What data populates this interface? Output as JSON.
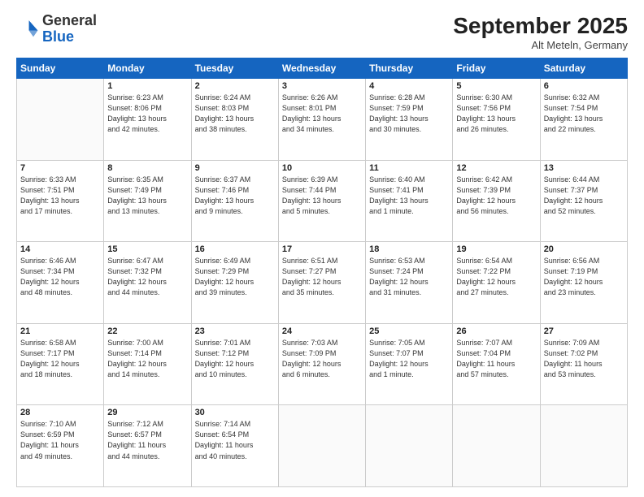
{
  "header": {
    "logo_general": "General",
    "logo_blue": "Blue",
    "month_title": "September 2025",
    "location": "Alt Meteln, Germany"
  },
  "days_of_week": [
    "Sunday",
    "Monday",
    "Tuesday",
    "Wednesday",
    "Thursday",
    "Friday",
    "Saturday"
  ],
  "weeks": [
    [
      {
        "day": "",
        "info": ""
      },
      {
        "day": "1",
        "info": "Sunrise: 6:23 AM\nSunset: 8:06 PM\nDaylight: 13 hours\nand 42 minutes."
      },
      {
        "day": "2",
        "info": "Sunrise: 6:24 AM\nSunset: 8:03 PM\nDaylight: 13 hours\nand 38 minutes."
      },
      {
        "day": "3",
        "info": "Sunrise: 6:26 AM\nSunset: 8:01 PM\nDaylight: 13 hours\nand 34 minutes."
      },
      {
        "day": "4",
        "info": "Sunrise: 6:28 AM\nSunset: 7:59 PM\nDaylight: 13 hours\nand 30 minutes."
      },
      {
        "day": "5",
        "info": "Sunrise: 6:30 AM\nSunset: 7:56 PM\nDaylight: 13 hours\nand 26 minutes."
      },
      {
        "day": "6",
        "info": "Sunrise: 6:32 AM\nSunset: 7:54 PM\nDaylight: 13 hours\nand 22 minutes."
      }
    ],
    [
      {
        "day": "7",
        "info": "Sunrise: 6:33 AM\nSunset: 7:51 PM\nDaylight: 13 hours\nand 17 minutes."
      },
      {
        "day": "8",
        "info": "Sunrise: 6:35 AM\nSunset: 7:49 PM\nDaylight: 13 hours\nand 13 minutes."
      },
      {
        "day": "9",
        "info": "Sunrise: 6:37 AM\nSunset: 7:46 PM\nDaylight: 13 hours\nand 9 minutes."
      },
      {
        "day": "10",
        "info": "Sunrise: 6:39 AM\nSunset: 7:44 PM\nDaylight: 13 hours\nand 5 minutes."
      },
      {
        "day": "11",
        "info": "Sunrise: 6:40 AM\nSunset: 7:41 PM\nDaylight: 13 hours\nand 1 minute."
      },
      {
        "day": "12",
        "info": "Sunrise: 6:42 AM\nSunset: 7:39 PM\nDaylight: 12 hours\nand 56 minutes."
      },
      {
        "day": "13",
        "info": "Sunrise: 6:44 AM\nSunset: 7:37 PM\nDaylight: 12 hours\nand 52 minutes."
      }
    ],
    [
      {
        "day": "14",
        "info": "Sunrise: 6:46 AM\nSunset: 7:34 PM\nDaylight: 12 hours\nand 48 minutes."
      },
      {
        "day": "15",
        "info": "Sunrise: 6:47 AM\nSunset: 7:32 PM\nDaylight: 12 hours\nand 44 minutes."
      },
      {
        "day": "16",
        "info": "Sunrise: 6:49 AM\nSunset: 7:29 PM\nDaylight: 12 hours\nand 39 minutes."
      },
      {
        "day": "17",
        "info": "Sunrise: 6:51 AM\nSunset: 7:27 PM\nDaylight: 12 hours\nand 35 minutes."
      },
      {
        "day": "18",
        "info": "Sunrise: 6:53 AM\nSunset: 7:24 PM\nDaylight: 12 hours\nand 31 minutes."
      },
      {
        "day": "19",
        "info": "Sunrise: 6:54 AM\nSunset: 7:22 PM\nDaylight: 12 hours\nand 27 minutes."
      },
      {
        "day": "20",
        "info": "Sunrise: 6:56 AM\nSunset: 7:19 PM\nDaylight: 12 hours\nand 23 minutes."
      }
    ],
    [
      {
        "day": "21",
        "info": "Sunrise: 6:58 AM\nSunset: 7:17 PM\nDaylight: 12 hours\nand 18 minutes."
      },
      {
        "day": "22",
        "info": "Sunrise: 7:00 AM\nSunset: 7:14 PM\nDaylight: 12 hours\nand 14 minutes."
      },
      {
        "day": "23",
        "info": "Sunrise: 7:01 AM\nSunset: 7:12 PM\nDaylight: 12 hours\nand 10 minutes."
      },
      {
        "day": "24",
        "info": "Sunrise: 7:03 AM\nSunset: 7:09 PM\nDaylight: 12 hours\nand 6 minutes."
      },
      {
        "day": "25",
        "info": "Sunrise: 7:05 AM\nSunset: 7:07 PM\nDaylight: 12 hours\nand 1 minute."
      },
      {
        "day": "26",
        "info": "Sunrise: 7:07 AM\nSunset: 7:04 PM\nDaylight: 11 hours\nand 57 minutes."
      },
      {
        "day": "27",
        "info": "Sunrise: 7:09 AM\nSunset: 7:02 PM\nDaylight: 11 hours\nand 53 minutes."
      }
    ],
    [
      {
        "day": "28",
        "info": "Sunrise: 7:10 AM\nSunset: 6:59 PM\nDaylight: 11 hours\nand 49 minutes."
      },
      {
        "day": "29",
        "info": "Sunrise: 7:12 AM\nSunset: 6:57 PM\nDaylight: 11 hours\nand 44 minutes."
      },
      {
        "day": "30",
        "info": "Sunrise: 7:14 AM\nSunset: 6:54 PM\nDaylight: 11 hours\nand 40 minutes."
      },
      {
        "day": "",
        "info": ""
      },
      {
        "day": "",
        "info": ""
      },
      {
        "day": "",
        "info": ""
      },
      {
        "day": "",
        "info": ""
      }
    ]
  ]
}
